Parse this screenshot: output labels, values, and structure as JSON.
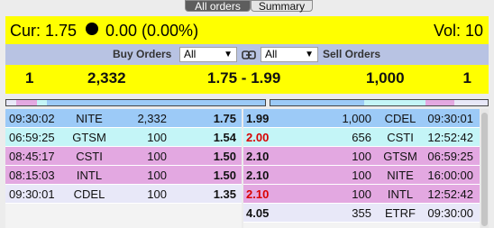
{
  "tabs": [
    {
      "label": "All orders",
      "active": true
    },
    {
      "label": "Summary",
      "active": false
    }
  ],
  "quote": {
    "cur_text": "Cur: 1.75",
    "change_text": "0.00 (0.00%)",
    "vol_text": "Vol: 10"
  },
  "filters": {
    "buy_label": "Buy Orders",
    "buy_select_value": "All",
    "sell_label": "Sell Orders",
    "sell_select_value": "All",
    "link_icon": "link-icon"
  },
  "summary": {
    "buy_count": "1",
    "buy_size": "2,332",
    "price_range": "1.75 - 1.99",
    "sell_size": "1,000",
    "sell_count": "1"
  },
  "colors": {
    "yellow": "#ffff00",
    "filter_bar": "#b8c3e3",
    "blue_row": "#9ccaf7",
    "cyan_row": "#c4f5f7",
    "pink_row": "#e3a8e1",
    "lavender_row": "#e8e8f8",
    "red_price": "#d90000"
  },
  "buy_orders": [
    {
      "time": "09:30:02",
      "mm": "NITE",
      "size": "2,332",
      "price": "1.75",
      "color": "#9ccaf7"
    },
    {
      "time": "06:59:25",
      "mm": "GTSM",
      "size": "100",
      "price": "1.54",
      "color": "#c4f5f7"
    },
    {
      "time": "08:45:17",
      "mm": "CSTI",
      "size": "100",
      "price": "1.50",
      "color": "#e3a8e1"
    },
    {
      "time": "08:15:03",
      "mm": "INTL",
      "size": "100",
      "price": "1.50",
      "color": "#e3a8e1"
    },
    {
      "time": "09:30:01",
      "mm": "CDEL",
      "size": "100",
      "price": "1.35",
      "color": "#e8e8f8"
    }
  ],
  "sell_orders": [
    {
      "price": "1.99",
      "red": false,
      "size": "1,000",
      "mm": "CDEL",
      "time": "09:30:01",
      "color": "#9ccaf7"
    },
    {
      "price": "2.00",
      "red": true,
      "size": "656",
      "mm": "CSTI",
      "time": "12:52:42",
      "color": "#c4f5f7"
    },
    {
      "price": "2.10",
      "red": false,
      "size": "100",
      "mm": "GTSM",
      "time": "06:59:25",
      "color": "#e3a8e1"
    },
    {
      "price": "2.10",
      "red": false,
      "size": "100",
      "mm": "NITE",
      "time": "16:00:00",
      "color": "#e3a8e1"
    },
    {
      "price": "2.10",
      "red": true,
      "size": "100",
      "mm": "INTL",
      "time": "12:52:42",
      "color": "#e3a8e1"
    },
    {
      "price": "4.05",
      "red": false,
      "size": "355",
      "mm": "ETRF",
      "time": "09:30:00",
      "color": "#e8e8f8"
    }
  ]
}
